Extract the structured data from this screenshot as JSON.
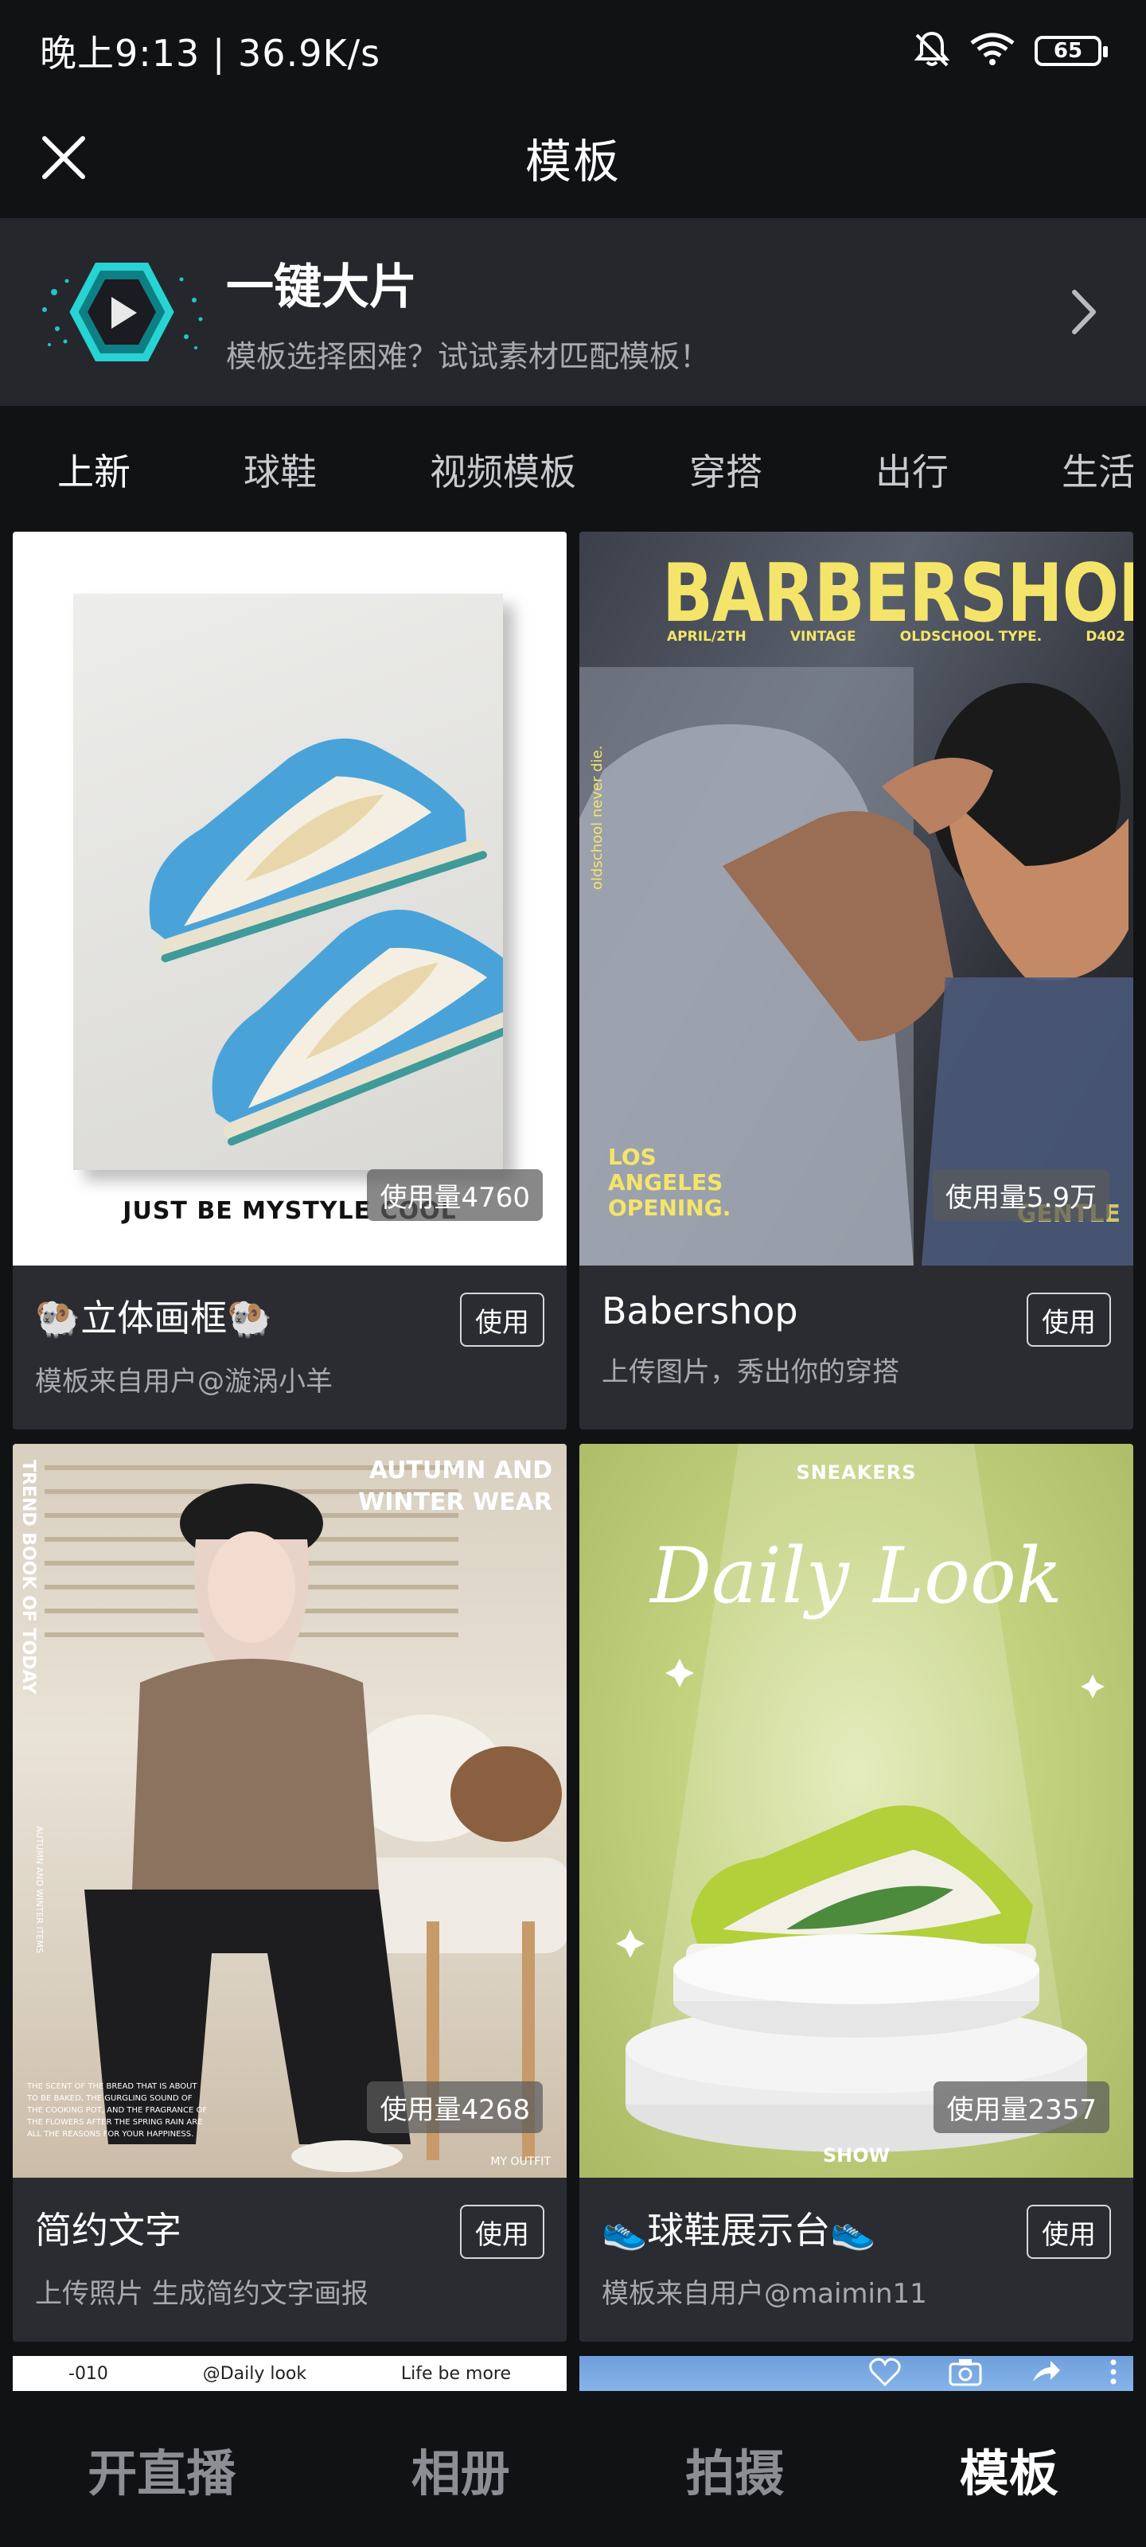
{
  "status_bar": {
    "time_speed": "晚上9:13 | 36.9K/s",
    "battery": "65"
  },
  "header": {
    "title": "模板"
  },
  "promo": {
    "title": "一键大片",
    "subtitle": "模板选择困难？试试素材匹配模板！"
  },
  "tabs": [
    "上新",
    "球鞋",
    "视频模板",
    "穿搭",
    "出行",
    "生活"
  ],
  "cards": [
    {
      "title": "🐏立体画框🐏",
      "desc": "模板来自用户@漩涡小羊",
      "usage": "使用量4760",
      "use_label": "使用",
      "image_text": "JUST BE MYSTYLE COOL"
    },
    {
      "title": "Babershop",
      "desc": "上传图片，秀出你的穿搭",
      "usage": "使用量5.9万",
      "use_label": "使用",
      "image_text": {
        "headline": "BARBERSHOP",
        "meta1": "APRIL/2TH",
        "meta2": "VINTAGE",
        "meta3": "OLDSCHOOL TYPE.",
        "meta4": "D402",
        "side": "oldschool never die.",
        "caption": "LOS ANGELES OPENING.",
        "corner": "GENTLE"
      }
    },
    {
      "title": "简约文字",
      "desc": "上传照片 生成简约文字画报",
      "usage": "使用量4268",
      "use_label": "使用",
      "image_text": {
        "top_right": "AUTUMN AND WINTER WEAR",
        "side": "TREND BOOK OF TODAY",
        "side_small": "AUTUMN AND WINTER ITEMS",
        "bottom_small": "THE SCENT OF THE BREAD THAT IS ABOUT TO BE BAKED, THE GURGLING SOUND OF THE COOKING POT, AND THE FRAGRANCE OF THE FLOWERS AFTER THE SPRING RAIN ARE ALL THE REASONS FOR YOUR HAPPINESS.",
        "bottom_right": "MY OUTFIT"
      }
    },
    {
      "title": "👟球鞋展示台👟",
      "desc": "模板来自用户@maimin11",
      "usage": "使用量2357",
      "use_label": "使用",
      "image_text": {
        "top": "SNEAKERS",
        "script": "Daily Look",
        "bottom": "SHOW"
      }
    }
  ],
  "partial_row": {
    "left_a": "-010",
    "left_b": "@Daily look",
    "left_c": "Life be more"
  },
  "bottom_nav": [
    "开直播",
    "相册",
    "拍摄",
    "模板"
  ],
  "colors": {
    "background": "#111214",
    "card": "#2b2c31",
    "promo_bg": "#26272c",
    "accent_teal": "#1fc7c7",
    "muted_text": "#a9aab0"
  }
}
